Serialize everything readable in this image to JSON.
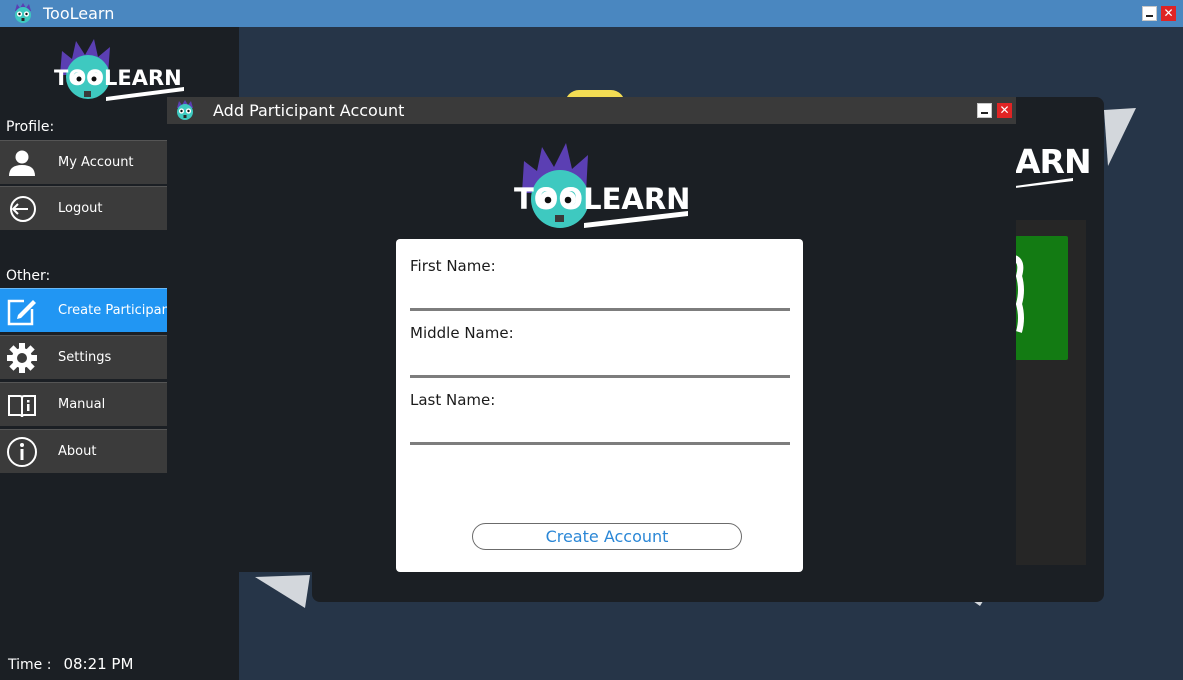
{
  "window": {
    "title": "TooLearn",
    "close_label": "✕"
  },
  "sidebar": {
    "logo_text": "TOOLEARN",
    "profile_label": "Profile:",
    "other_label": "Other:",
    "profile_items": [
      {
        "label": "My Account",
        "icon": "user-icon"
      },
      {
        "label": "Logout",
        "icon": "logout-icon"
      }
    ],
    "other_items": [
      {
        "label": "Create Participant",
        "icon": "edit-icon"
      },
      {
        "label": "Settings",
        "icon": "gear-icon"
      },
      {
        "label": "Manual",
        "icon": "book-icon"
      },
      {
        "label": "About",
        "icon": "info-icon"
      }
    ],
    "time_label": "Time :",
    "time_value": "08:21 PM"
  },
  "background": {
    "logo_fragment": "ARN"
  },
  "dialog": {
    "title": "Add Participant Account",
    "close_label": "✕",
    "logo_text": "TOOLEARN",
    "fields": [
      {
        "label": "First Name:",
        "value": ""
      },
      {
        "label": "Middle Name:",
        "value": ""
      },
      {
        "label": "Last Name:",
        "value": ""
      }
    ],
    "submit_label": "Create Account"
  },
  "colors": {
    "accent": "#2196f3",
    "titlebar": "#4a87c0",
    "sidebar": "#1b1f24",
    "button_text": "#2b87d6"
  }
}
